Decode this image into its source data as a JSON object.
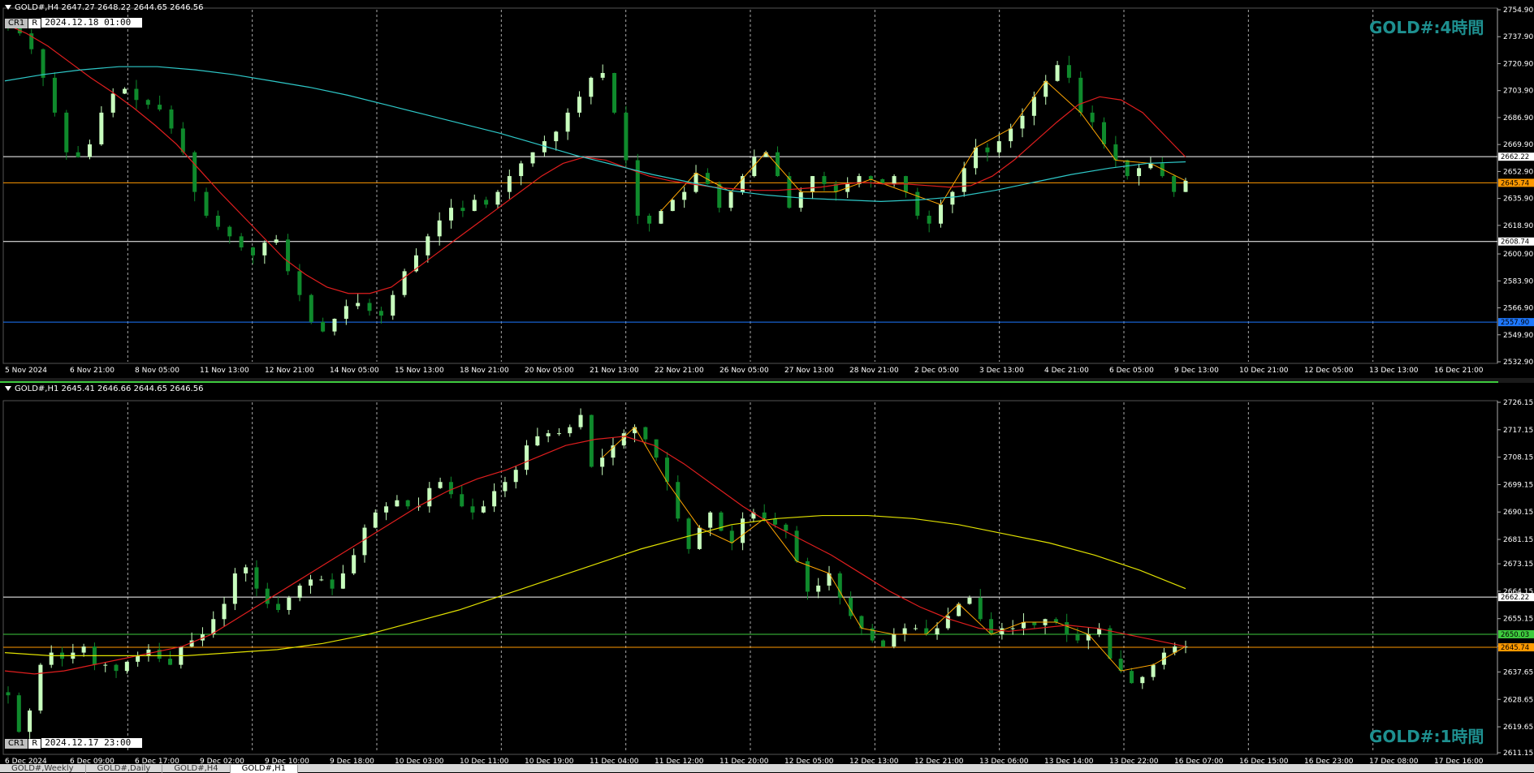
{
  "colors": {
    "bg": "#000000",
    "bull": "#c8ffbe",
    "bear": "#0f8a2c",
    "grid": "#ffffff",
    "redma": "#e01e1e",
    "cyanma": "#2ec8c8",
    "yellowma": "#e0e000",
    "zigzag": "#ffa500",
    "orange": "#ff9900",
    "blue": "#1e78ff",
    "green": "#3ecb3e",
    "title": "#1e9090"
  },
  "top": {
    "header": "GOLD#,H4  2647.27 2648.22 2644.65 2646.56",
    "chip_cr": "CR1",
    "chip_r": "R",
    "date_chip": "2024.12.18 01:00",
    "title": "GOLD#:4時間",
    "chart_data": {
      "type": "candlestick",
      "ylim": [
        2532.9,
        2754.9
      ],
      "y_ticks": [
        "2754.90",
        "2737.90",
        "2720.90",
        "2703.90",
        "2686.90",
        "2669.90",
        "2652.90",
        "2635.90",
        "2618.90",
        "2600.90",
        "2583.90",
        "2566.90",
        "2549.90",
        "2532.90"
      ],
      "x_labels": [
        "5 Nov 2024",
        "6 Nov 21:00",
        "8 Nov 05:00",
        "11 Nov 13:00",
        "12 Nov 21:00",
        "14 Nov 05:00",
        "15 Nov 13:00",
        "18 Nov 21:00",
        "20 Nov 05:00",
        "21 Nov 13:00",
        "22 Nov 21:00",
        "26 Nov 05:00",
        "27 Nov 13:00",
        "28 Nov 21:00",
        "2 Dec 05:00",
        "3 Dec 13:00",
        "4 Dec 21:00",
        "6 Dec 05:00",
        "9 Dec 13:00",
        "10 Dec 21:00",
        "12 Dec 05:00",
        "13 Dec 13:00",
        "16 Dec 21:00"
      ],
      "hlines": [
        {
          "label": "2662.22",
          "value": 2662.22,
          "color": "#ffffff"
        },
        {
          "label": "2645.74",
          "value": 2645.74,
          "color": "#ff9900"
        },
        {
          "label": "2608.74",
          "value": 2608.74,
          "color": "#ffffff"
        },
        {
          "label": "2557.90",
          "value": 2557.9,
          "color": "#1e78ff"
        }
      ],
      "closes": [
        2745,
        2740,
        2730,
        2712,
        2690,
        2665,
        2662,
        2670,
        2690,
        2702,
        2705,
        2698,
        2695,
        2692,
        2680,
        2665,
        2640,
        2625,
        2618,
        2612,
        2605,
        2600,
        2608,
        2610,
        2590,
        2575,
        2558,
        2552,
        2560,
        2568,
        2570,
        2565,
        2562,
        2575,
        2590,
        2600,
        2612,
        2622,
        2630,
        2628,
        2635,
        2632,
        2640,
        2650,
        2658,
        2665,
        2672,
        2678,
        2690,
        2700,
        2712,
        2715,
        2690,
        2660,
        2625,
        2620,
        2628,
        2635,
        2640,
        2652,
        2645,
        2630,
        2640,
        2650,
        2662,
        2665,
        2650,
        2630,
        2640,
        2650,
        2645,
        2640,
        2645,
        2650,
        2648,
        2645,
        2650,
        2640,
        2625,
        2620,
        2632,
        2640,
        2655,
        2668,
        2665,
        2672,
        2680,
        2688,
        2700,
        2710,
        2720,
        2712,
        2690,
        2684,
        2670,
        2660,
        2650,
        2655,
        2658,
        2650,
        2640,
        2647
      ],
      "red_ma": [
        2746,
        2740,
        2732,
        2722,
        2712,
        2703,
        2693,
        2682,
        2670,
        2655,
        2640,
        2626,
        2612,
        2598,
        2588,
        2580,
        2576,
        2576,
        2580,
        2590,
        2600,
        2610,
        2620,
        2630,
        2640,
        2650,
        2658,
        2662,
        2660,
        2655,
        2650,
        2647,
        2645,
        2643,
        2642,
        2641,
        2641,
        2642,
        2643,
        2645,
        2646,
        2645,
        2645,
        2644,
        2643,
        2644,
        2650,
        2660,
        2672,
        2684,
        2695,
        2700,
        2698,
        2690,
        2676,
        2662
      ],
      "cyan_ma": [
        2710,
        2714,
        2717,
        2719,
        2719,
        2717,
        2714,
        2710,
        2706,
        2701,
        2695,
        2689,
        2683,
        2677,
        2670,
        2663,
        2657,
        2651,
        2646,
        2641,
        2638,
        2636,
        2635,
        2634,
        2635,
        2637,
        2641,
        2646,
        2651,
        2655,
        2658,
        2659
      ]
    }
  },
  "bottom": {
    "header": "GOLD#,H1  2645.41 2646.66 2644.65 2646.56",
    "chip_cr": "CR1",
    "chip_r": "R",
    "date_chip": "2024.12.17 23:00",
    "title": "GOLD#:1時間",
    "chart_data": {
      "type": "candlestick",
      "ylim": [
        2611.15,
        2726.15
      ],
      "y_ticks": [
        "2726.15",
        "2717.15",
        "2708.15",
        "2699.15",
        "2690.15",
        "2681.15",
        "2673.15",
        "2664.15",
        "2655.15",
        "2646.15",
        "2637.65",
        "2628.65",
        "2619.65",
        "2611.15"
      ],
      "x_labels": [
        "6 Dec 2024",
        "6 Dec 09:00",
        "6 Dec 17:00",
        "9 Dec 02:00",
        "9 Dec 10:00",
        "9 Dec 18:00",
        "10 Dec 03:00",
        "10 Dec 11:00",
        "10 Dec 19:00",
        "11 Dec 04:00",
        "11 Dec 12:00",
        "11 Dec 20:00",
        "12 Dec 05:00",
        "12 Dec 13:00",
        "12 Dec 21:00",
        "13 Dec 06:00",
        "13 Dec 14:00",
        "13 Dec 22:00",
        "16 Dec 07:00",
        "16 Dec 15:00",
        "16 Dec 23:00",
        "17 Dec 08:00",
        "17 Dec 16:00"
      ],
      "hlines": [
        {
          "label": "2662.22",
          "value": 2662.22,
          "color": "#ffffff"
        },
        {
          "label": "2650.03",
          "value": 2650.03,
          "color": "#3ecb3e"
        },
        {
          "label": "2645.74",
          "value": 2645.74,
          "color": "#ff9900"
        }
      ],
      "closes": [
        2630,
        2618,
        2625,
        2640,
        2644,
        2642,
        2644,
        2646,
        2640,
        2640,
        2638,
        2641,
        2643,
        2645,
        2642,
        2640,
        2646,
        2648,
        2650,
        2655,
        2660,
        2670,
        2672,
        2665,
        2660,
        2658,
        2662,
        2666,
        2668,
        2668,
        2665,
        2670,
        2676,
        2685,
        2690,
        2692,
        2694,
        2692,
        2692,
        2698,
        2700,
        2696,
        2692,
        2690,
        2692,
        2697,
        2700,
        2704,
        2712,
        2715,
        2716,
        2716,
        2718,
        2722,
        2705,
        2708,
        2712,
        2716,
        2718,
        2714,
        2708,
        2700,
        2688,
        2678,
        2685,
        2690,
        2684,
        2680,
        2688,
        2690,
        2688,
        2686,
        2684,
        2674,
        2664,
        2666,
        2670,
        2662,
        2656,
        2652,
        2648,
        2646,
        2650,
        2652,
        2652,
        2650,
        2652,
        2656,
        2660,
        2662,
        2655,
        2650,
        2652,
        2652,
        2654,
        2653,
        2655,
        2654,
        2650,
        2648,
        2650,
        2652,
        2642,
        2638,
        2634,
        2636,
        2640,
        2644,
        2646,
        2646
      ],
      "red_ma": [
        2638,
        2637,
        2638,
        2640,
        2642,
        2644,
        2646,
        2650,
        2656,
        2662,
        2668,
        2674,
        2680,
        2686,
        2692,
        2697,
        2701,
        2704,
        2708,
        2712,
        2714,
        2715,
        2712,
        2706,
        2699,
        2692,
        2686,
        2681,
        2676,
        2670,
        2664,
        2659,
        2655,
        2652,
        2651,
        2652,
        2653,
        2652,
        2650,
        2648,
        2646
      ],
      "yellow_ma": [
        2644,
        2643,
        2643,
        2643,
        2643,
        2644,
        2645,
        2647,
        2650,
        2654,
        2658,
        2663,
        2668,
        2673,
        2678,
        2682,
        2686,
        2688,
        2689,
        2689,
        2688,
        2686,
        2683,
        2680,
        2676,
        2671,
        2665
      ]
    }
  },
  "tabs": [
    "GOLD#,Weekly",
    "GOLD#,Daily",
    "GOLD#,H4",
    "GOLD#,H1"
  ]
}
